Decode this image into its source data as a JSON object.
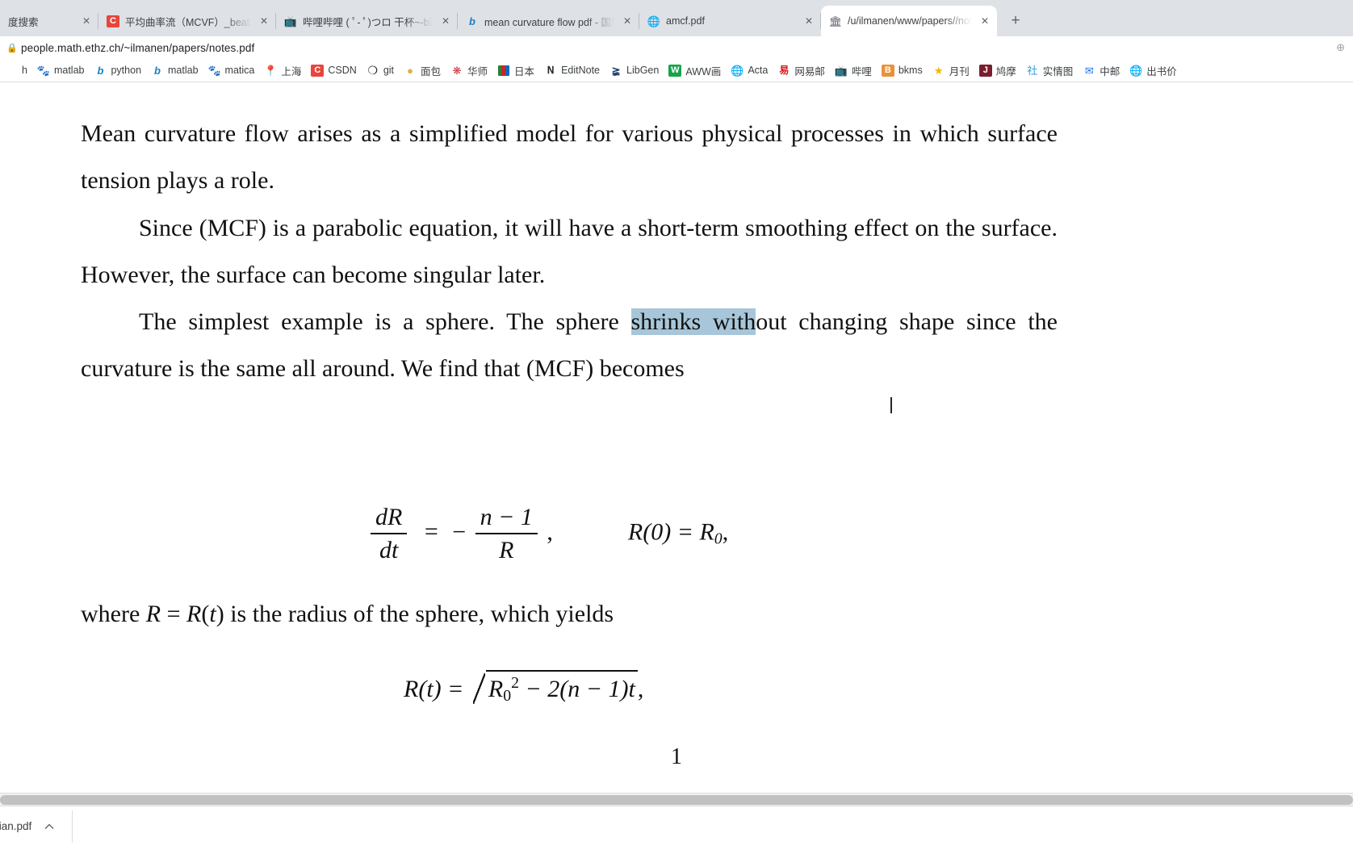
{
  "browser": {
    "tabs": [
      {
        "title": "度搜索",
        "favicon": "baidu-icon",
        "active": false
      },
      {
        "title": "平均曲率流（MCVF）_beatbea",
        "favicon": "chrome-icon",
        "active": false
      },
      {
        "title": "哔哩哔哩 ( ﾟ- ﾟ)つロ 干杯~-bili",
        "favicon": "bilibili-icon",
        "active": false
      },
      {
        "title": "mean curvature flow pdf - 国际",
        "favicon": "bing-icon",
        "active": false
      },
      {
        "title": "amcf.pdf",
        "favicon": "globe-icon",
        "active": false
      },
      {
        "title": "/u/ilmanen/www/papers//not",
        "favicon": "bank-icon",
        "active": true
      }
    ],
    "new_tab_label": "+",
    "close_label": "✕",
    "address": {
      "lock_icon": "lock-icon",
      "url": "people.math.ethz.ch/~ilmanen/papers/notes.pdf"
    },
    "bookmarks": [
      {
        "label": "h",
        "icon": "baidu-icon",
        "icon_class": "i-baidu",
        "glyph": ""
      },
      {
        "label": "matlab",
        "icon": "baidu-icon",
        "icon_class": "i-baidu",
        "glyph": "🐾"
      },
      {
        "label": "python",
        "icon": "bing-icon",
        "icon_class": "i-bing",
        "glyph": "b"
      },
      {
        "label": "matlab",
        "icon": "bing-icon",
        "icon_class": "i-bing",
        "glyph": "b"
      },
      {
        "label": "matica",
        "icon": "baidu-icon",
        "icon_class": "i-baidu",
        "glyph": "🐾"
      },
      {
        "label": "上海",
        "icon": "pin-icon",
        "icon_class": "i-pin",
        "glyph": "📍"
      },
      {
        "label": "CSDN",
        "icon": "csdn-icon",
        "icon_class": "i-csdn",
        "glyph": "C"
      },
      {
        "label": "git",
        "icon": "github-icon",
        "icon_class": "i-git",
        "glyph": "❍"
      },
      {
        "label": "面包",
        "icon": "bread-icon",
        "icon_class": "i-bread",
        "glyph": "●"
      },
      {
        "label": "华师",
        "icon": "huashi-icon",
        "icon_class": "i-hua",
        "glyph": "❋"
      },
      {
        "label": "日本",
        "icon": "japan-icon",
        "icon_class": "i-jp",
        "glyph": ""
      },
      {
        "label": "EditNote",
        "icon": "editnote-icon",
        "icon_class": "i-edit",
        "glyph": "ꓠ"
      },
      {
        "label": "LibGen",
        "icon": "libgen-icon",
        "icon_class": "i-libgen",
        "glyph": "≩"
      },
      {
        "label": "AWW画",
        "icon": "aww-icon",
        "icon_class": "i-aww",
        "glyph": "W"
      },
      {
        "label": "Acta",
        "icon": "globe-icon",
        "icon_class": "i-acta",
        "glyph": "🌐"
      },
      {
        "label": "网易邮",
        "icon": "netease-icon",
        "icon_class": "i-163",
        "glyph": "易"
      },
      {
        "label": "哔哩",
        "icon": "bilibili-icon",
        "icon_class": "i-bili",
        "glyph": "📺"
      },
      {
        "label": "bkms",
        "icon": "bkms-icon",
        "icon_class": "i-bkms",
        "glyph": "B"
      },
      {
        "label": "月刊",
        "icon": "star-icon",
        "icon_class": "i-star",
        "glyph": "★"
      },
      {
        "label": "鸠摩",
        "icon": "jiumo-icon",
        "icon_class": "i-j",
        "glyph": "J"
      },
      {
        "label": "实情图",
        "icon": "shiqing-icon",
        "icon_class": "i-sq",
        "glyph": "社"
      },
      {
        "label": "中邮",
        "icon": "mail-icon",
        "icon_class": "i-mail",
        "glyph": "✉"
      },
      {
        "label": "出书价",
        "icon": "globe-icon",
        "icon_class": "i-globe",
        "glyph": "🌐"
      }
    ]
  },
  "document": {
    "paragraphs": {
      "p1": "Mean curvature flow arises as a simplified model for various physical processes in which surface tension plays a role.",
      "p2": "Since (MCF) is a parabolic equation, it will have a short-term smoothing effect on the surface. However, the surface can become singular later.",
      "p3_pre": "The simplest example is a sphere.  The sphere ",
      "p3_highlight": "shrinks with",
      "p3_post": "out changing shape since the curvature is the same all around.   We find that (MCF) becomes",
      "p4": "where R = R(t) is the radius of the sphere, which yields"
    },
    "equations": {
      "eq1": {
        "lhs_num": "dR",
        "lhs_den": "dt",
        "eq_sign": "=",
        "minus": "−",
        "rhs_num": "n − 1",
        "rhs_den": "R",
        "comma": ",",
        "initial": "R(0) = R",
        "initial_sub": "0",
        "initial_comma": ","
      },
      "eq2": {
        "lhs": "R(t) =",
        "radicand_base": "R",
        "radicand_sub": "0",
        "radicand_sup": "2",
        "radicand_rest": " − 2(n − 1)t",
        "trailing": ","
      }
    },
    "page_number": "1",
    "selection_color": "#a8c6d9"
  },
  "download_shelf": {
    "filename": "cian.pdf",
    "chevron_icon": "chevron-up-icon"
  },
  "scrollbar": {
    "orientation": "horizontal"
  }
}
